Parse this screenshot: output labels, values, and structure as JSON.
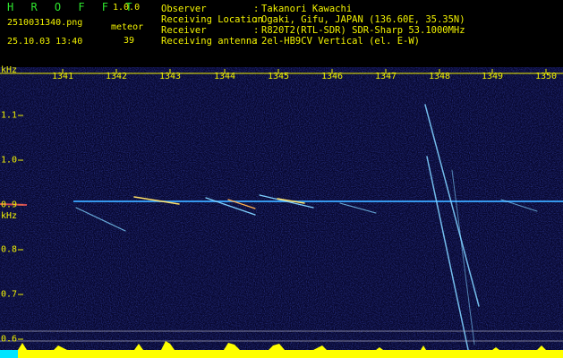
{
  "header": {
    "app_name": "H R O F F T",
    "version": "1.0.0",
    "filename": "2510031340.png",
    "meteor_label": "meteor",
    "timestamp": "25.10.03 13:40",
    "meteor_count": "39",
    "fields": [
      {
        "label": "Observer",
        "value": "Takanori Kawachi"
      },
      {
        "label": "Receiving Location",
        "value": "Ogaki, Gifu, JAPAN (136.60E, 35.35N)"
      },
      {
        "label": "Receiver",
        "value": "R820T2(RTL-SDR) SDR-Sharp 53.1000MHz"
      },
      {
        "label": "Receiving antenna",
        "value": "2el-HB9CV Vertical (el. E-W)"
      }
    ]
  },
  "axis": {
    "unit_top": "kHz",
    "unit_side": "kHz",
    "x_ticks": [
      "1341",
      "1342",
      "1343",
      "1344",
      "1345",
      "1346",
      "1347",
      "1348",
      "1349",
      "1350"
    ],
    "y_ticks": [
      "1.1",
      "1.0",
      "0.9",
      "0.8",
      "0.7",
      "0.6"
    ]
  },
  "colors": {
    "background": "#000000",
    "label": "#f2f200",
    "brand": "#2ee52e",
    "noise_floor": "#07072e",
    "carrier": "#3aa6ff",
    "meteor_trail": "#7fd0ff",
    "meteor_core": "#ffe066",
    "level_bar_cyan": "#00e5ff",
    "level_bar_yellow": "#ffff00"
  }
}
